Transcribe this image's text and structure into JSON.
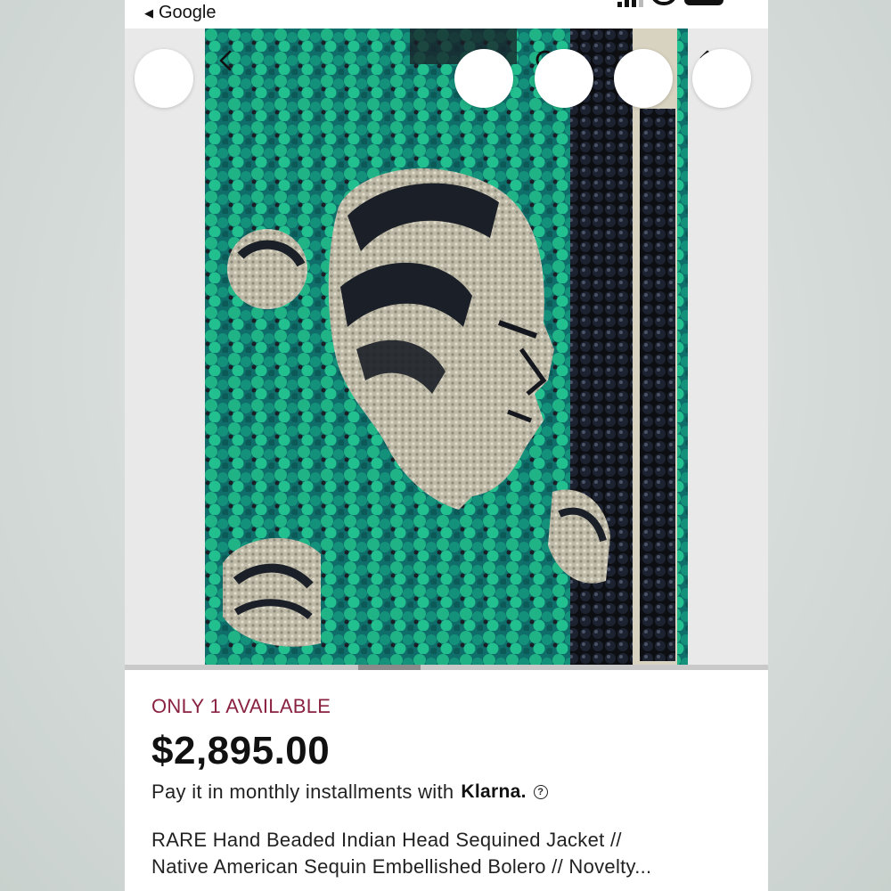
{
  "status_bar": {
    "back_app_label": "Google"
  },
  "listing": {
    "availability": "ONLY 1 AVAILABLE",
    "price": "$2,895.00",
    "installments_prefix": "Pay it in monthly installments with",
    "klarna_brand": "Klarna.",
    "title_line1": "RARE Hand Beaded Indian Head Sequined Jacket //",
    "title_line2": "Native American Sequin Embellished Bolero // Novelty..."
  },
  "icons": {
    "back": "chevron-left-icon",
    "search": "search-icon",
    "message": "message-icon",
    "share": "share-icon",
    "favorite": "heart-icon"
  },
  "colors": {
    "availability": "#8a2241",
    "sequin_green": "#1aa37a",
    "sequin_teal": "#0f6e6a",
    "bead_silver": "#c9c6b3",
    "bead_black": "#15171c"
  }
}
